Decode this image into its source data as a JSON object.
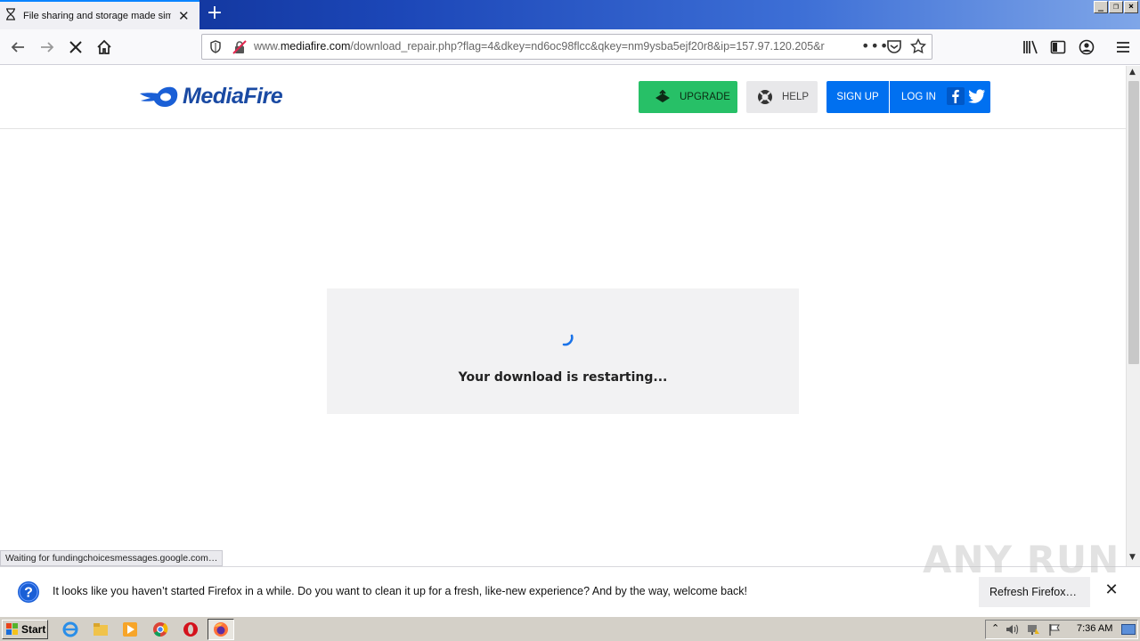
{
  "browser": {
    "tab_title": "File sharing and storage made simple",
    "url_prefix": "www.",
    "url_host": "mediafire.com",
    "url_path": "/download_repair.php?flag=4&dkey=nd6oc98flcc&qkey=nm9ysba5ejf20r8&ip=157.97.120.205&r",
    "status_text": "Waiting for fundingchoicesmessages.google.com…"
  },
  "site": {
    "logo_text": "MediaFire",
    "upgrade_label": "UPGRADE",
    "help_label": "HELP",
    "signup_label": "SIGN UP",
    "login_label": "LOG IN",
    "brand_blue": "#0070f0",
    "upgrade_green": "#27c067"
  },
  "main": {
    "restart_message": "Your download is restarting..."
  },
  "notification": {
    "message": "It looks like you haven’t started Firefox in a while. Do you want to clean it up for a fresh, like-new experience? And by the way, welcome back!",
    "refresh_label": "Refresh Firefox…"
  },
  "watermark": "ANY RUN",
  "taskbar": {
    "start_label": "Start",
    "clock": "7:36 AM"
  }
}
